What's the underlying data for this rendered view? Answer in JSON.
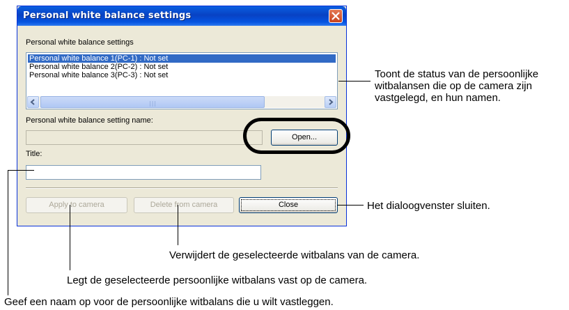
{
  "dialog": {
    "title": "Personal white balance settings",
    "section_label": "Personal white balance settings",
    "list_items": [
      "Personal white balance 1(PC-1) : Not set",
      "Personal white balance 2(PC-2) : Not set",
      "Personal white balance 3(PC-3) : Not set"
    ],
    "setting_name_label": "Personal white balance setting name:",
    "setting_name_value": "",
    "title_label": "Title:",
    "title_value": "",
    "open_button": "Open...",
    "apply_button": "Apply to camera",
    "delete_button": "Delete from camera",
    "close_button": "Close"
  },
  "annotations": {
    "status_list": "Toont de status van de persoonlijke witbalansen die op de camera zijn vastgelegd, en hun namen.",
    "close_dialog": "Het dialoogvenster sluiten.",
    "delete": "Verwijdert de geselecteerde witbalans van de camera.",
    "apply": "Legt de geselecteerde persoonlijke witbalans vast op de camera.",
    "name": "Geef een naam op voor de persoonlijke witbalans die u wilt vastleggen."
  },
  "colors": {
    "titlebar": "#0842c4",
    "selection": "#316ac5",
    "dialog_bg": "#ece9d8",
    "close_button": "#c9431e"
  }
}
